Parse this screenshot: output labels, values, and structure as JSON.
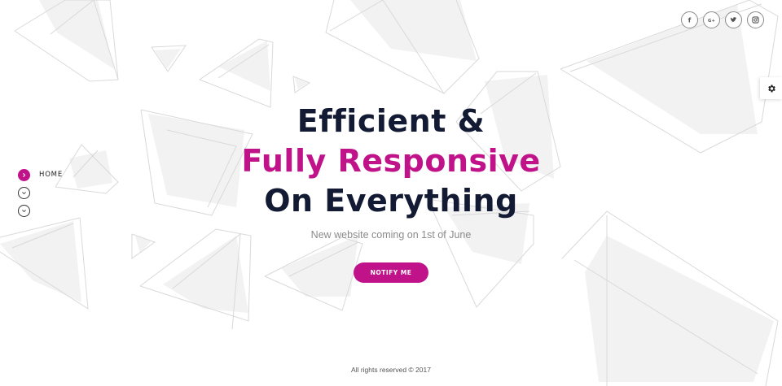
{
  "hero": {
    "line1": "Efficient &",
    "line2": "Fully Responsive",
    "line3": "On Everything",
    "subtitle": "New website coming on 1st of June",
    "cta_label": "NOTIFY ME"
  },
  "nav": {
    "items": [
      {
        "label": "HOME",
        "active": true
      },
      {
        "label": "",
        "active": false
      },
      {
        "label": "",
        "active": false
      }
    ]
  },
  "social": {
    "icons": [
      "facebook-icon",
      "google-plus-icon",
      "twitter-icon",
      "instagram-icon"
    ],
    "labels": [
      "f",
      "G+"
    ]
  },
  "settings": {
    "icon": "gear-icon"
  },
  "footer": {
    "text": "All rights reserved © 2017"
  },
  "colors": {
    "accent": "#c0138a",
    "heading": "#131a33",
    "subtitle": "#8a8a8a",
    "background": "#ffffff",
    "shape_fill": "#f2f2f2",
    "shape_stroke": "#d9d9d9"
  }
}
